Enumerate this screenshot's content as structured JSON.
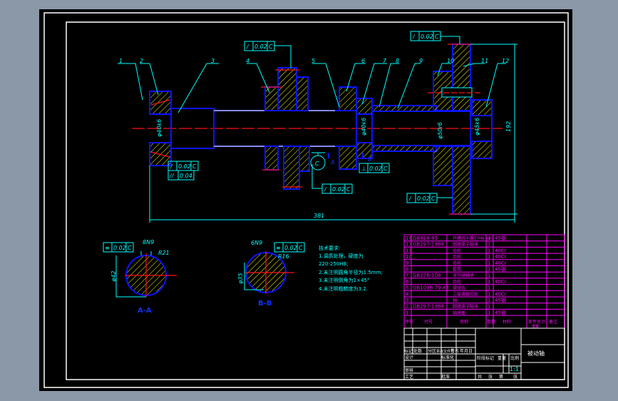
{
  "colors": {
    "background": "#8a98a8",
    "paper": "#000000",
    "outline": "#0a14ff",
    "annotation": "#00ffff",
    "centerline": "#ff1010",
    "hatch": "#ffff00",
    "parts_list": "#ff00ff",
    "frame": "#ffffff"
  },
  "part_labels": [
    "1",
    "2",
    "3",
    "4",
    "5",
    "6",
    "7",
    "8",
    "9",
    "10",
    "11",
    "12"
  ],
  "section_marks": {
    "a": "A",
    "b": "B",
    "datum": "C"
  },
  "tolerances": {
    "runout_symbol": "/",
    "parallel_symbol": "//",
    "perp_symbol": "⊥",
    "symmetry_symbol": "≡",
    "v002": "0.02",
    "v004": "0.04",
    "datum": "C"
  },
  "dimensions": {
    "length": "381",
    "height": "192",
    "d1": "φ40k6",
    "d2": "φ40k6",
    "d3": "φ50r6",
    "d4": "φ45k6",
    "key_a": "8N9",
    "key_b": "6N9",
    "r_a": "R21",
    "r_b": "R16",
    "dia_a": "φ42",
    "dia_b": "φ35"
  },
  "sections": {
    "a": "A-A",
    "b": "B-B"
  },
  "notes": [
    "技术要求:",
    "1.调质处理，硬度为",
    "220-250HB;",
    "2.未注明圆角半径为1.5mm;",
    "3.未注明倒角为1×45°",
    "4.未注明粗糙度为3.2."
  ],
  "parts_list": {
    "rows": [
      {
        "no": "14",
        "code": "GB818-85",
        "name": "开槽沉头螺钉M6×25",
        "qty": "4",
        "material": "45钢"
      },
      {
        "no": "13",
        "code": "GB297-1984",
        "name": "圆锥滚子轴承",
        "qty": "1",
        "material": ""
      },
      {
        "no": "11",
        "code": "",
        "name": "齿轮",
        "qty": "1",
        "material": "40Cr"
      },
      {
        "no": "10",
        "code": "",
        "name": "齿轮",
        "qty": "1",
        "material": "40Cr"
      },
      {
        "no": "9",
        "code": "",
        "name": "齿轮",
        "qty": "1",
        "material": "40Cr"
      },
      {
        "no": "8",
        "code": "",
        "name": "套筒",
        "qty": "1",
        "material": "45钢"
      },
      {
        "no": "7",
        "code": "GB276-108",
        "name": "深沟球轴承",
        "qty": "1",
        "material": ""
      },
      {
        "no": "6",
        "code": "",
        "name": "齿轮",
        "qty": "1",
        "material": "40Cr"
      },
      {
        "no": "5",
        "code": "GB1096-79 A5",
        "name": "键组合",
        "qty": "1",
        "material": ""
      },
      {
        "no": "4",
        "code": "",
        "name": "三联滑移齿轮",
        "qty": "1",
        "material": "40Cr"
      },
      {
        "no": "3",
        "code": "",
        "name": "轴",
        "qty": "1",
        "material": "45钢"
      },
      {
        "no": "2",
        "code": "GB297-1984",
        "name": "圆锥滚子轴承",
        "qty": "1",
        "material": ""
      },
      {
        "no": "1",
        "code": "",
        "name": "轴承盖",
        "qty": "1",
        "material": "45钢"
      }
    ],
    "header": {
      "no": "序号",
      "code": "代号",
      "name": "名称",
      "qty": "数量",
      "material": "材料",
      "unit": "单件",
      "total": "总计",
      "weight": "重量",
      "remark": "备注"
    }
  },
  "title_block": {
    "mark": "标记",
    "count": "处数",
    "zone": "分区",
    "change": "更改文件号",
    "sign": "签名",
    "date": "年月日",
    "design": "设计",
    "standard": "标准化",
    "check": "审核",
    "process": "工艺",
    "approve": "批准",
    "stage": "阶段标记",
    "weight": "重量",
    "scale_label": "比例",
    "scale": "1:1",
    "total_sheets": "共",
    "sheet": "张",
    "sheet_no": "第",
    "sheet2": "张",
    "drawing_title": "被动轴"
  }
}
